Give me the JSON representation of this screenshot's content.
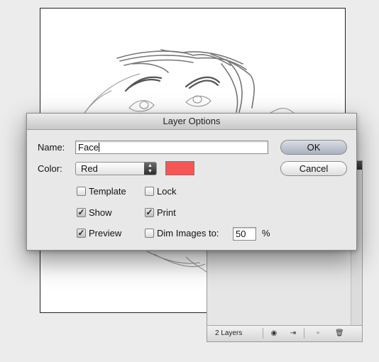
{
  "dialog": {
    "title": "Layer Options",
    "name_label": "Name:",
    "name_value": "Face",
    "color_label": "Color:",
    "color_value": "Red",
    "swatch_color": "#f55656",
    "ok_label": "OK",
    "cancel_label": "Cancel",
    "options": {
      "template": {
        "label": "Template",
        "checked": false
      },
      "lock": {
        "label": "Lock",
        "checked": false
      },
      "show": {
        "label": "Show",
        "checked": true
      },
      "print": {
        "label": "Print",
        "checked": true
      },
      "preview": {
        "label": "Preview",
        "checked": true
      },
      "dim_images": {
        "label": "Dim Images to:",
        "checked": false
      }
    },
    "dim_value": "50",
    "dim_unit": "%"
  },
  "layers_panel": {
    "count": "2 Layers",
    "footer_icons": [
      "locate-object-icon",
      "make-clipping-mask-icon",
      "new-sublayer-icon",
      "new-layer-icon",
      "trash-icon"
    ]
  }
}
